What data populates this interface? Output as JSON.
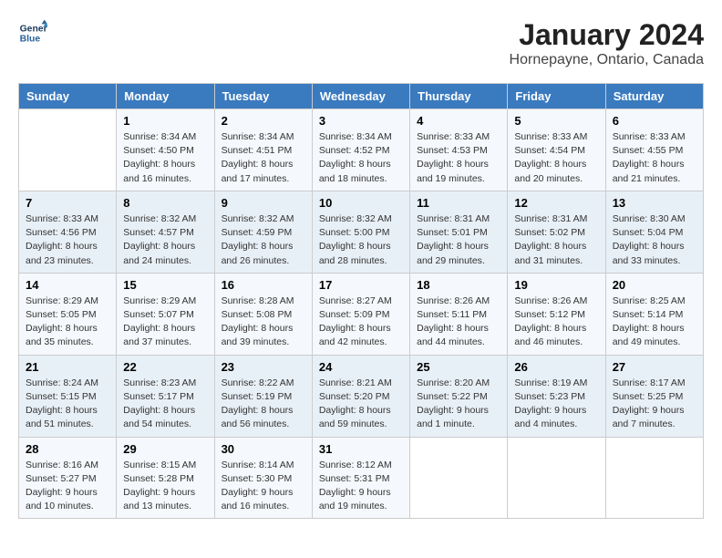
{
  "logo": {
    "line1": "General",
    "line2": "Blue"
  },
  "title": "January 2024",
  "subtitle": "Hornepayne, Ontario, Canada",
  "days_of_week": [
    "Sunday",
    "Monday",
    "Tuesday",
    "Wednesday",
    "Thursday",
    "Friday",
    "Saturday"
  ],
  "weeks": [
    [
      {
        "day": "",
        "info": ""
      },
      {
        "day": "1",
        "info": "Sunrise: 8:34 AM\nSunset: 4:50 PM\nDaylight: 8 hours\nand 16 minutes."
      },
      {
        "day": "2",
        "info": "Sunrise: 8:34 AM\nSunset: 4:51 PM\nDaylight: 8 hours\nand 17 minutes."
      },
      {
        "day": "3",
        "info": "Sunrise: 8:34 AM\nSunset: 4:52 PM\nDaylight: 8 hours\nand 18 minutes."
      },
      {
        "day": "4",
        "info": "Sunrise: 8:33 AM\nSunset: 4:53 PM\nDaylight: 8 hours\nand 19 minutes."
      },
      {
        "day": "5",
        "info": "Sunrise: 8:33 AM\nSunset: 4:54 PM\nDaylight: 8 hours\nand 20 minutes."
      },
      {
        "day": "6",
        "info": "Sunrise: 8:33 AM\nSunset: 4:55 PM\nDaylight: 8 hours\nand 21 minutes."
      }
    ],
    [
      {
        "day": "7",
        "info": "Sunrise: 8:33 AM\nSunset: 4:56 PM\nDaylight: 8 hours\nand 23 minutes."
      },
      {
        "day": "8",
        "info": "Sunrise: 8:32 AM\nSunset: 4:57 PM\nDaylight: 8 hours\nand 24 minutes."
      },
      {
        "day": "9",
        "info": "Sunrise: 8:32 AM\nSunset: 4:59 PM\nDaylight: 8 hours\nand 26 minutes."
      },
      {
        "day": "10",
        "info": "Sunrise: 8:32 AM\nSunset: 5:00 PM\nDaylight: 8 hours\nand 28 minutes."
      },
      {
        "day": "11",
        "info": "Sunrise: 8:31 AM\nSunset: 5:01 PM\nDaylight: 8 hours\nand 29 minutes."
      },
      {
        "day": "12",
        "info": "Sunrise: 8:31 AM\nSunset: 5:02 PM\nDaylight: 8 hours\nand 31 minutes."
      },
      {
        "day": "13",
        "info": "Sunrise: 8:30 AM\nSunset: 5:04 PM\nDaylight: 8 hours\nand 33 minutes."
      }
    ],
    [
      {
        "day": "14",
        "info": "Sunrise: 8:29 AM\nSunset: 5:05 PM\nDaylight: 8 hours\nand 35 minutes."
      },
      {
        "day": "15",
        "info": "Sunrise: 8:29 AM\nSunset: 5:07 PM\nDaylight: 8 hours\nand 37 minutes."
      },
      {
        "day": "16",
        "info": "Sunrise: 8:28 AM\nSunset: 5:08 PM\nDaylight: 8 hours\nand 39 minutes."
      },
      {
        "day": "17",
        "info": "Sunrise: 8:27 AM\nSunset: 5:09 PM\nDaylight: 8 hours\nand 42 minutes."
      },
      {
        "day": "18",
        "info": "Sunrise: 8:26 AM\nSunset: 5:11 PM\nDaylight: 8 hours\nand 44 minutes."
      },
      {
        "day": "19",
        "info": "Sunrise: 8:26 AM\nSunset: 5:12 PM\nDaylight: 8 hours\nand 46 minutes."
      },
      {
        "day": "20",
        "info": "Sunrise: 8:25 AM\nSunset: 5:14 PM\nDaylight: 8 hours\nand 49 minutes."
      }
    ],
    [
      {
        "day": "21",
        "info": "Sunrise: 8:24 AM\nSunset: 5:15 PM\nDaylight: 8 hours\nand 51 minutes."
      },
      {
        "day": "22",
        "info": "Sunrise: 8:23 AM\nSunset: 5:17 PM\nDaylight: 8 hours\nand 54 minutes."
      },
      {
        "day": "23",
        "info": "Sunrise: 8:22 AM\nSunset: 5:19 PM\nDaylight: 8 hours\nand 56 minutes."
      },
      {
        "day": "24",
        "info": "Sunrise: 8:21 AM\nSunset: 5:20 PM\nDaylight: 8 hours\nand 59 minutes."
      },
      {
        "day": "25",
        "info": "Sunrise: 8:20 AM\nSunset: 5:22 PM\nDaylight: 9 hours\nand 1 minute."
      },
      {
        "day": "26",
        "info": "Sunrise: 8:19 AM\nSunset: 5:23 PM\nDaylight: 9 hours\nand 4 minutes."
      },
      {
        "day": "27",
        "info": "Sunrise: 8:17 AM\nSunset: 5:25 PM\nDaylight: 9 hours\nand 7 minutes."
      }
    ],
    [
      {
        "day": "28",
        "info": "Sunrise: 8:16 AM\nSunset: 5:27 PM\nDaylight: 9 hours\nand 10 minutes."
      },
      {
        "day": "29",
        "info": "Sunrise: 8:15 AM\nSunset: 5:28 PM\nDaylight: 9 hours\nand 13 minutes."
      },
      {
        "day": "30",
        "info": "Sunrise: 8:14 AM\nSunset: 5:30 PM\nDaylight: 9 hours\nand 16 minutes."
      },
      {
        "day": "31",
        "info": "Sunrise: 8:12 AM\nSunset: 5:31 PM\nDaylight: 9 hours\nand 19 minutes."
      },
      {
        "day": "",
        "info": ""
      },
      {
        "day": "",
        "info": ""
      },
      {
        "day": "",
        "info": ""
      }
    ]
  ]
}
